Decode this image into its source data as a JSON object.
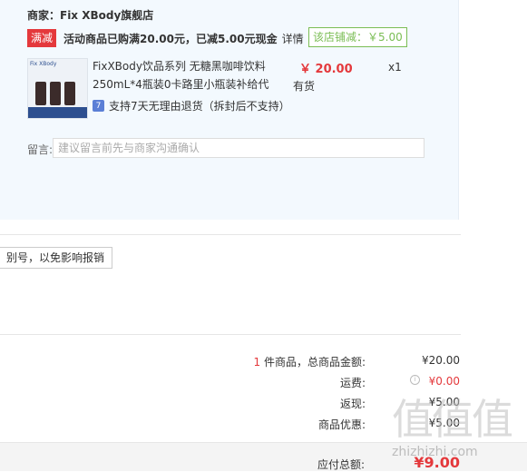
{
  "shop": {
    "title": "商家：Fix XBody旗舰店",
    "promo_tag": "满减",
    "promo_text": "活动商品已购满20.00元，已减5.00元现金",
    "promo_detail": "详情",
    "store_discount": "该店铺减：￥5.00"
  },
  "product": {
    "image_label": "Fix XBody",
    "name": "FixXBody饮品系列 无糖黑咖啡饮料250mL*4瓶装0卡路里小瓶装补给代",
    "price": "￥ 20.00",
    "stock": "有货",
    "qty": "x1",
    "return_icon": "7",
    "return_text": "支持7天无理由退货（拆封后不支持）"
  },
  "message": {
    "label": "留言:",
    "placeholder": "建议留言前先与商家沟通确认"
  },
  "invoice_note": "别号，以免影响报销",
  "summary": {
    "count": "1",
    "count_label": " 件商品，总商品金额:",
    "total": "¥20.00",
    "shipping_label": "运费:",
    "shipping": "¥0.00",
    "rebate_label": "返现:",
    "rebate": "¥5.00",
    "discount_label": "商品优惠:",
    "discount": "¥5.00",
    "pay_label": "应付总额:",
    "pay": "¥9.00"
  },
  "watermark": {
    "glyphs": "值值值",
    "url": "zhizhizhi.com"
  },
  "colors": {
    "accent_red": "#e4393c",
    "discount_green": "#7abd54",
    "shop_bg": "#f3f9fe"
  }
}
